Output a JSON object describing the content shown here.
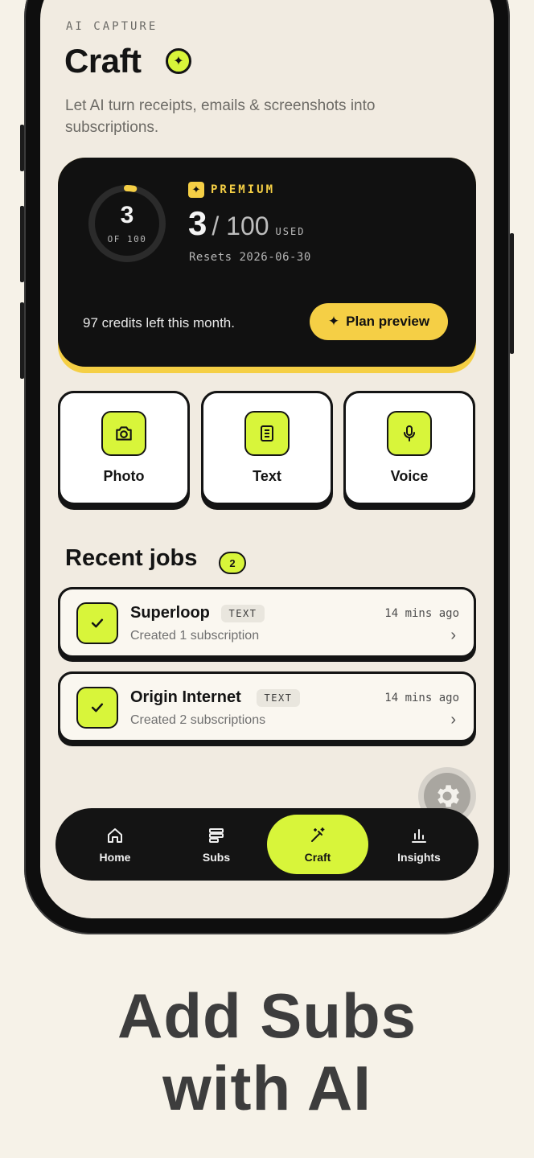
{
  "header": {
    "eyebrow": "AI CAPTURE",
    "title": "Craft",
    "subtitle": "Let AI turn receipts, emails & screenshots into subscriptions."
  },
  "usage": {
    "ring_value": "3",
    "ring_caption": "OF 100",
    "ring_progress": 0.03,
    "tier": "PREMIUM",
    "used": "3",
    "total": "/ 100",
    "used_word": "USED",
    "resets": "Resets 2026-06-30",
    "credits_text": "97 credits left this month.",
    "plan_button": "Plan preview",
    "colors": {
      "accent": "#f5cf45",
      "card": "#111111"
    }
  },
  "capture": {
    "tiles": [
      {
        "label": "Photo",
        "icon": "camera-icon"
      },
      {
        "label": "Text",
        "icon": "document-icon"
      },
      {
        "label": "Voice",
        "icon": "microphone-icon"
      }
    ]
  },
  "recent": {
    "title": "Recent jobs",
    "count": "2",
    "jobs": [
      {
        "name": "Superloop",
        "tag": "TEXT",
        "subtitle": "Created 1 subscription",
        "time": "14 mins ago"
      },
      {
        "name": "Origin Internet",
        "tag": "TEXT",
        "subtitle": "Created 2 subscriptions",
        "time": "14 mins ago"
      }
    ]
  },
  "tabs": [
    {
      "label": "Home",
      "icon": "home-icon"
    },
    {
      "label": "Subs",
      "icon": "list-icon"
    },
    {
      "label": "Craft",
      "icon": "magic-wand-icon",
      "active": true
    },
    {
      "label": "Insights",
      "icon": "bar-chart-icon"
    }
  ],
  "headline": {
    "line1": "Add Subs",
    "line2": "with AI"
  },
  "theme": {
    "lime": "#d8f53a",
    "background": "#f1ebe1",
    "ink": "#141414"
  }
}
